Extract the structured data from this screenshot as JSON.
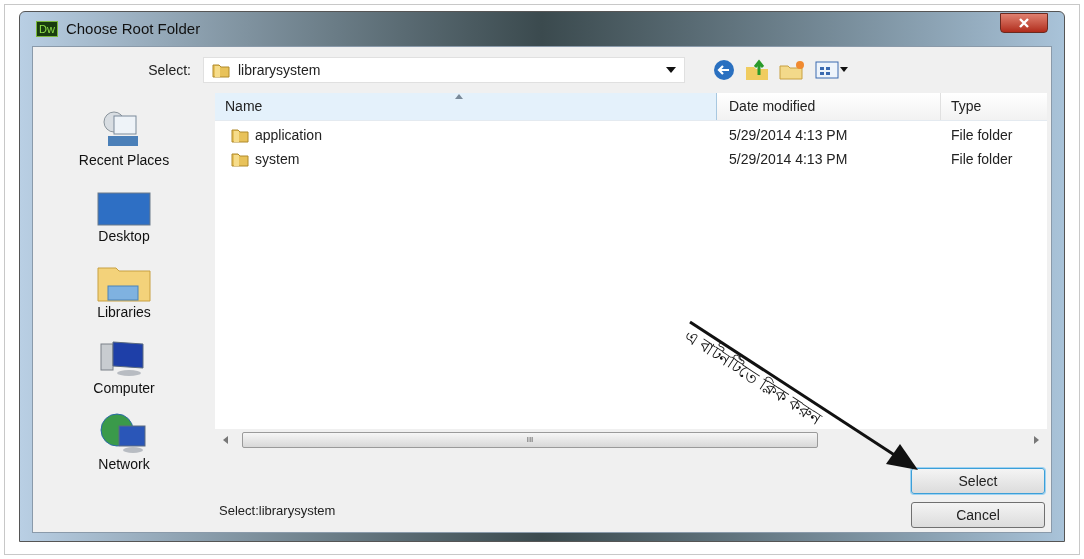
{
  "window": {
    "title": "Choose Root Folder",
    "app_badge": "Dw"
  },
  "select_field": {
    "label": "Select:",
    "value": "librarysystem"
  },
  "sidebar": {
    "items": [
      {
        "label": "Recent Places",
        "kind": "recent"
      },
      {
        "label": "Desktop",
        "kind": "desktop"
      },
      {
        "label": "Libraries",
        "kind": "libraries"
      },
      {
        "label": "Computer",
        "kind": "computer"
      },
      {
        "label": "Network",
        "kind": "network"
      }
    ]
  },
  "table": {
    "columns": [
      "Name",
      "Date modified",
      "Type"
    ],
    "rows": [
      {
        "name": "application",
        "date": "5/29/2014 4:13 PM",
        "type": "File folder"
      },
      {
        "name": "system",
        "date": "5/29/2014 4:13 PM",
        "type": "File folder"
      }
    ],
    "scrollbar_glyph": "III"
  },
  "status": "Select:librarysystem",
  "buttons": [
    {
      "label": "Select",
      "kind": "default"
    },
    {
      "label": "Cancel",
      "kind": "normal"
    }
  ],
  "annotation": "এ বাটনটিতে ক্লিক করুন"
}
